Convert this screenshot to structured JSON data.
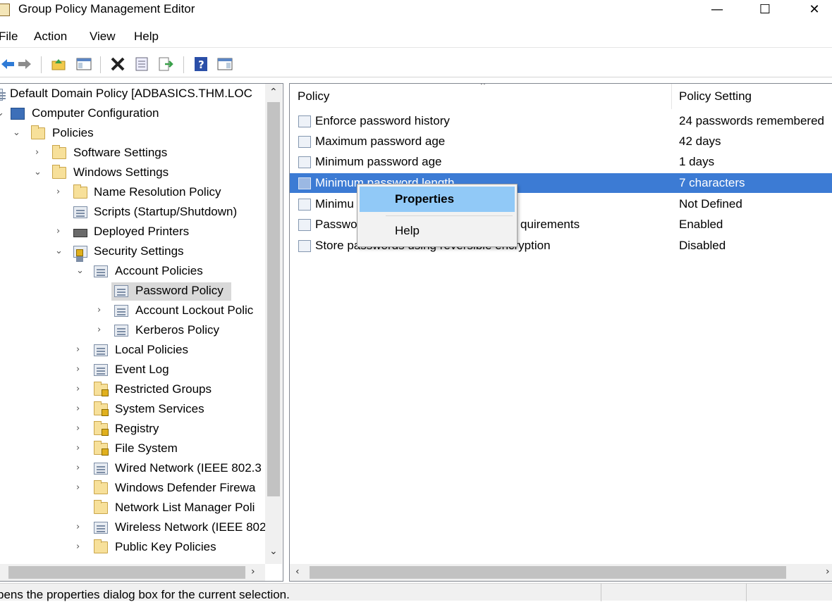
{
  "window": {
    "title": "Group Policy Management Editor",
    "minimize_glyph": "—",
    "maximize_glyph": "☐",
    "close_glyph": "✕"
  },
  "menu": [
    "File",
    "Action",
    "View",
    "Help"
  ],
  "toolbar": {
    "icons": [
      "back-arrow-icon",
      "forward-arrow-icon",
      "up-folder-icon",
      "show-hide-tree-icon",
      "delete-icon",
      "properties-icon",
      "export-list-icon",
      "help-icon",
      "show-hide-action-pane-icon"
    ]
  },
  "tree": {
    "root": "Default Domain Policy [ADBASICS.THM.LOC",
    "computer_configuration": "Computer Configuration",
    "policies": "Policies",
    "software_settings": "Software Settings",
    "windows_settings": "Windows Settings",
    "name_resolution_policy": "Name Resolution Policy",
    "scripts": "Scripts (Startup/Shutdown)",
    "deployed_printers": "Deployed Printers",
    "security_settings": "Security Settings",
    "account_policies": "Account Policies",
    "password_policy": "Password Policy",
    "account_lockout_policy": "Account Lockout Polic",
    "kerberos_policy": "Kerberos Policy",
    "local_policies": "Local Policies",
    "event_log": "Event Log",
    "restricted_groups": "Restricted Groups",
    "system_services": "System Services",
    "registry": "Registry",
    "file_system": "File System",
    "wired_network": "Wired Network (IEEE 802.3",
    "windows_defender_firewall": "Windows Defender Firewa",
    "network_list_manager": "Network List Manager Poli",
    "wireless_network": "Wireless Network (IEEE 802",
    "public_key_policies": "Public Key Policies"
  },
  "list": {
    "columns": {
      "policy": "Policy",
      "setting": "Policy Setting"
    },
    "rows": [
      {
        "policy": "Enforce password history",
        "setting": "24 passwords remembered"
      },
      {
        "policy": "Maximum password age",
        "setting": "42 days"
      },
      {
        "policy": "Minimum password age",
        "setting": "1 days"
      },
      {
        "policy": "Minimum password length",
        "setting": "7 characters"
      },
      {
        "policy": "Minimu",
        "setting": "Not Defined"
      },
      {
        "policy": "Passwo",
        "policy_tail": "quirements",
        "setting": "Enabled"
      },
      {
        "policy": "Store passwords using reversible encryption",
        "setting": "Disabled"
      }
    ]
  },
  "context_menu": {
    "properties": "Properties",
    "help": "Help"
  },
  "status": {
    "text": "pens the properties dialog box for the current selection."
  },
  "colors": {
    "selection": "#3c7bd4",
    "menu_highlight": "#91c9f7"
  }
}
